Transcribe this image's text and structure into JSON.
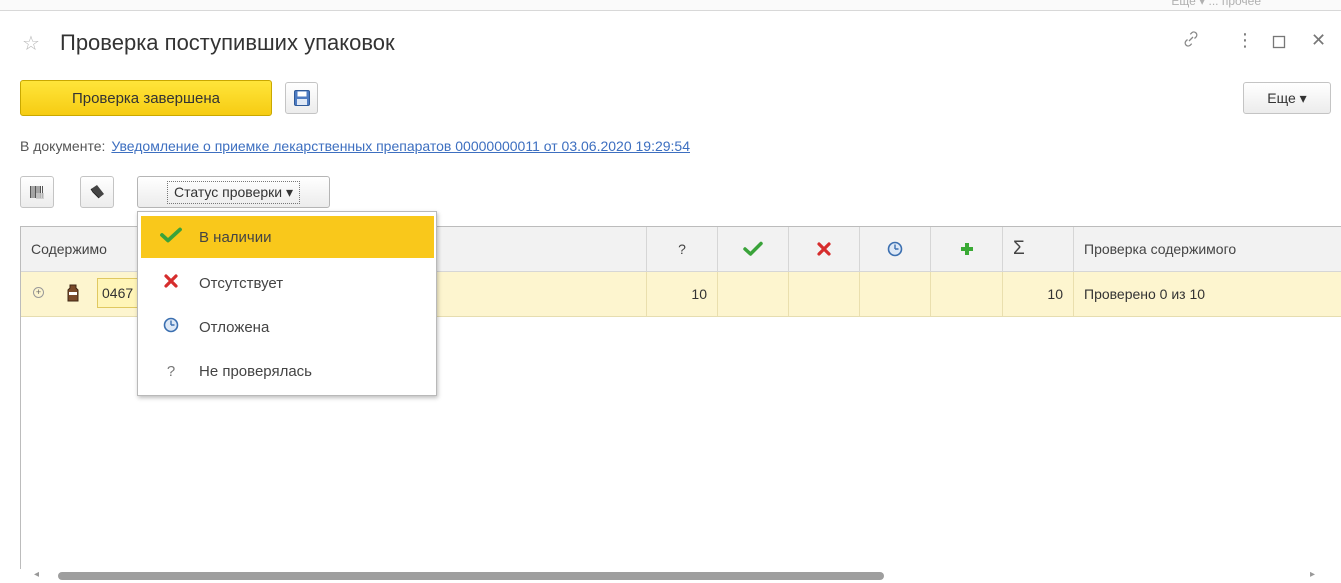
{
  "window": {
    "title": "Проверка поступивших упаковок",
    "background_tab_text": "Еще ▾ ... прочее"
  },
  "toolbar": {
    "done_label": "Проверка завершена",
    "more_label": "Еще ▾"
  },
  "document": {
    "prefix": "В документе:",
    "link_text": "Уведомление о приемке лекарственных препаратов 00000000011 от 03.06.2020 19:29:54"
  },
  "filter": {
    "status_label": "Статус проверки ▾"
  },
  "table": {
    "columns": {
      "content": "Содержимо",
      "unknown": "?",
      "sigma": "Σ",
      "check": "Проверка содержимого"
    },
    "rows": [
      {
        "code": "0467",
        "unknown": "10",
        "present": "",
        "absent": "",
        "postponed": "",
        "added": "",
        "total": "10",
        "check": "Проверено 0 из 10"
      }
    ]
  },
  "status_menu": {
    "items": [
      {
        "label": "В наличии",
        "icon": "check-icon",
        "selected": true
      },
      {
        "label": "Отсутствует",
        "icon": "cross-icon",
        "selected": false
      },
      {
        "label": "Отложена",
        "icon": "clock-icon",
        "selected": false
      },
      {
        "label": "Не проверялась",
        "icon": "question-icon",
        "glyph": "?",
        "selected": false
      }
    ]
  },
  "colors": {
    "accent_yellow": "#f9c81b",
    "row_highlight": "#fdf5cf",
    "link_blue": "#3d6fc0",
    "check_green": "#3aa33a",
    "cross_red": "#d62d2d",
    "plus_green": "#3aaa35",
    "clock_blue": "#3b6fb0"
  }
}
